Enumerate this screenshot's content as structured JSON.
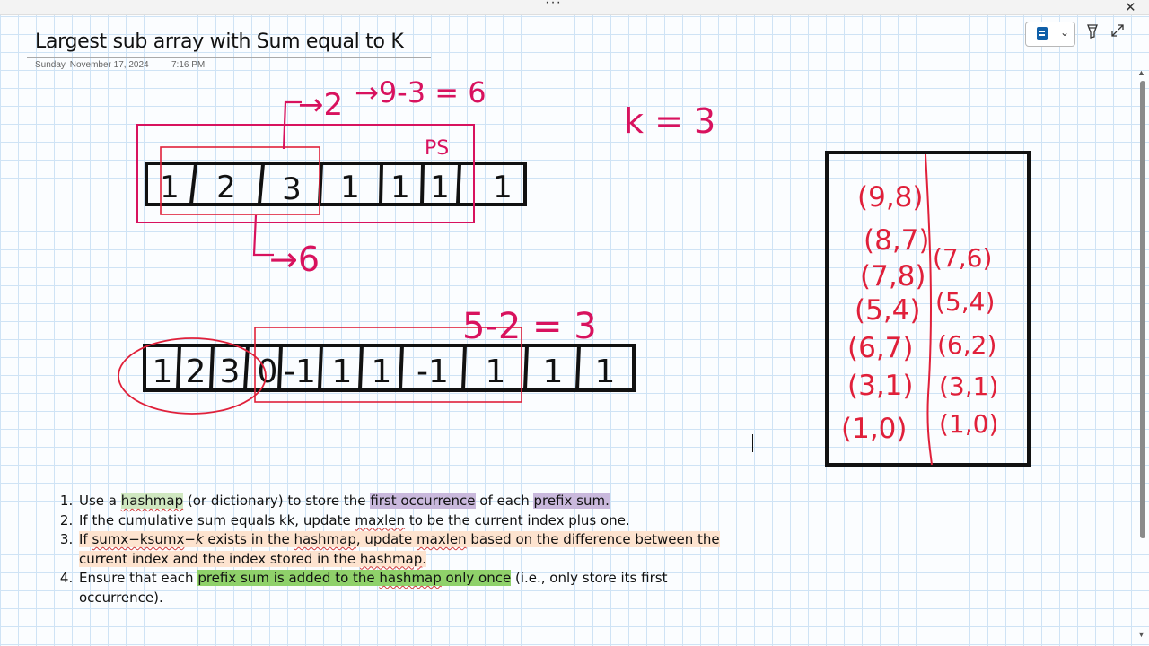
{
  "window": {
    "more_icon": "more-horizontal-icon",
    "close_glyph": "✕"
  },
  "page": {
    "title": "Largest sub array with Sum equal to K",
    "date": "Sunday, November 17, 2024",
    "time": "7:16 PM"
  },
  "toolbar": {
    "notebook_icon": "notebook-icon",
    "chevron": "⌄",
    "pen_icon": "pen-icon",
    "expand_icon": "expand-icon"
  },
  "ink": {
    "array1": [
      "1",
      "2",
      "3",
      "1",
      "1",
      "1",
      "1"
    ],
    "array2": [
      "1",
      "2",
      "3",
      "0",
      "-1",
      "1",
      "1",
      "-1",
      "1",
      "1",
      "1"
    ],
    "ann_two": "→2",
    "ann_formula": "→9-3 = 6",
    "ann_ps": "PS",
    "ann_six": "→6",
    "ann_k": "k = 3",
    "ann_formula2": "5-2 = 3",
    "map_left": [
      "(9,8)",
      "(8,7)",
      "(7,8)",
      "(5,4)",
      "(6,7)",
      "(3,1)",
      "(1,0)"
    ],
    "map_right": [
      "(7,6)",
      "(5,4)",
      "(6,2)",
      "(3,1)",
      "(1,0)"
    ],
    "ink_red": "#e0203a",
    "ink_magenta": "#d8125e"
  },
  "notes": [
    {
      "parts": [
        {
          "t": "Use a "
        },
        {
          "t": "hashmap",
          "hl": "green",
          "sq": true
        },
        {
          "t": " (or dictionary) to store the "
        },
        {
          "t": "first occurrence",
          "hl": "purple"
        },
        {
          "t": " of each "
        },
        {
          "t": "prefix sum.",
          "hl": "purple"
        }
      ]
    },
    {
      "parts": [
        {
          "t": "If the cumulative sum equals kk, update "
        },
        {
          "t": "maxlen",
          "sq": true
        },
        {
          "t": " to be the current index plus one."
        }
      ]
    },
    {
      "hl": "orange",
      "parts": [
        {
          "t": "If "
        },
        {
          "t": "sumx−ksumx",
          "sq": true
        },
        {
          "t": "−"
        },
        {
          "t": "k",
          "em": true
        },
        {
          "t": " exists in the "
        },
        {
          "t": "hashmap",
          "sq": true
        },
        {
          "t": ", update "
        },
        {
          "t": "maxlen",
          "sq": true
        },
        {
          "t": " based on the difference between the current index and the index stored in the "
        },
        {
          "t": "hashmap",
          "sq": true
        },
        {
          "t": "."
        }
      ]
    },
    {
      "parts": [
        {
          "t": "Ensure that each "
        },
        {
          "t": "prefix sum is added to the ",
          "hl": "bright"
        },
        {
          "t": "hashmap",
          "hl": "bright",
          "sq": true
        },
        {
          "t": " only once",
          "hl": "bright"
        },
        {
          "t": " (i.e., only store its first occurrence)."
        }
      ]
    }
  ]
}
